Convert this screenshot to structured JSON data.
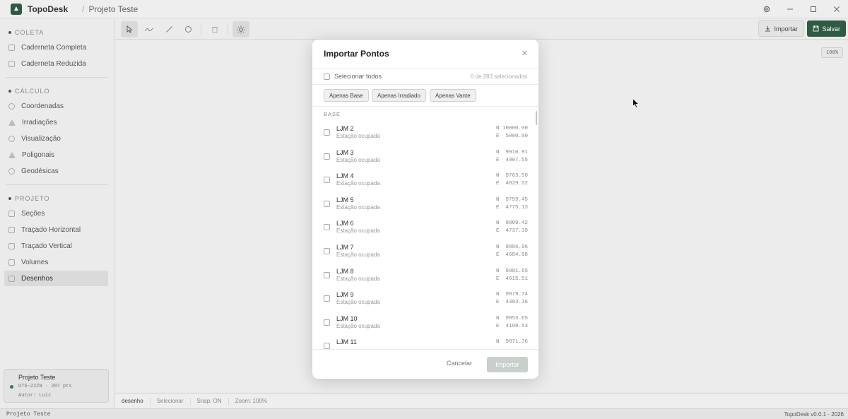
{
  "titlebar": {
    "app_name": "TopoDesk",
    "separator": "/",
    "project_title": "Projeto Teste",
    "controls": [
      "gear-icon",
      "minimize-icon",
      "maximize-icon",
      "close-icon"
    ]
  },
  "sidebar": {
    "sections": [
      {
        "title": "COLETA",
        "items": [
          {
            "label": "Caderneta Completa",
            "icon": "clipboard-icon",
            "active": false
          },
          {
            "label": "Caderneta Reduzida",
            "icon": "clipboard-icon",
            "active": false
          }
        ]
      },
      {
        "title": "CÁLCULO",
        "items": [
          {
            "label": "Coordenadas",
            "icon": "crosshair-icon",
            "active": false
          },
          {
            "label": "Irradiações",
            "icon": "triangle-icon",
            "active": false
          },
          {
            "label": "Visualização",
            "icon": "eye-icon",
            "active": false
          },
          {
            "label": "Poligonais",
            "icon": "triangle-icon",
            "active": false
          },
          {
            "label": "Geodésicas",
            "icon": "globe-icon",
            "active": false
          }
        ]
      },
      {
        "title": "PROJETO",
        "items": [
          {
            "label": "Seções",
            "icon": "lines-icon",
            "active": false
          },
          {
            "label": "Traçado Horizontal",
            "icon": "zigzag-icon",
            "active": false
          },
          {
            "label": "Traçado Vertical",
            "icon": "wave-icon",
            "active": false
          },
          {
            "label": "Volumes",
            "icon": "table-icon",
            "active": false
          },
          {
            "label": "Desenhos",
            "icon": "table-icon",
            "active": true
          }
        ]
      }
    ],
    "project_card": {
      "name": "Projeto Teste",
      "line1": "UTS-22ZN · 287 pts",
      "line2": "Autor: Luiz"
    }
  },
  "toolbar": {
    "import_label": "Importar",
    "save_label": "Salvar"
  },
  "canvas": {
    "zoom_chip": "100%"
  },
  "statusbar": {
    "mode": "desenho",
    "tool": "Selecionar",
    "snap": "Snap: ON",
    "zoom": "Zoom: 100%"
  },
  "footer": {
    "left": "Projeto Teste",
    "right": "TopoDesk v0.0.1 · 2026"
  },
  "modal": {
    "title": "Importar Pontos",
    "select_all": "Selecionar todos",
    "count": "0 de 283 selecionados",
    "filters": [
      "Apenas Base",
      "Apenas Irradiado",
      "Apenas Vante"
    ],
    "group": "BASE",
    "rows": [
      {
        "name": "LJM 2",
        "desc": "Estação ocupada",
        "n": "N 10000.00",
        "e": "E  5000.00"
      },
      {
        "name": "LJM 3",
        "desc": "Estação ocupada",
        "n": "N  9910.91",
        "e": "E  4907.55"
      },
      {
        "name": "LJM 4",
        "desc": "Estação ocupada",
        "n": "N  9763.50",
        "e": "E  4829.32"
      },
      {
        "name": "LJM 5",
        "desc": "Estação ocupada",
        "n": "N  9759.45",
        "e": "E  4775.13"
      },
      {
        "name": "LJM 6",
        "desc": "Estação ocupada",
        "n": "N  9809.42",
        "e": "E  4737.39"
      },
      {
        "name": "LJM 7",
        "desc": "Estação ocupada",
        "n": "N  9886.96",
        "e": "E  4684.98"
      },
      {
        "name": "LJM 8",
        "desc": "Estação ocupada",
        "n": "N  9901.65",
        "e": "E  4615.51"
      },
      {
        "name": "LJM 9",
        "desc": "Estação ocupada",
        "n": "N  9879.74",
        "e": "E  4383.36"
      },
      {
        "name": "LJM 10",
        "desc": "Estação ocupada",
        "n": "N  9853.65",
        "e": "E  4198.53"
      },
      {
        "name": "LJM 11",
        "desc": "",
        "n": "N  9871.76",
        "e": ""
      }
    ],
    "cancel": "Cancelar",
    "confirm": "Importar"
  }
}
